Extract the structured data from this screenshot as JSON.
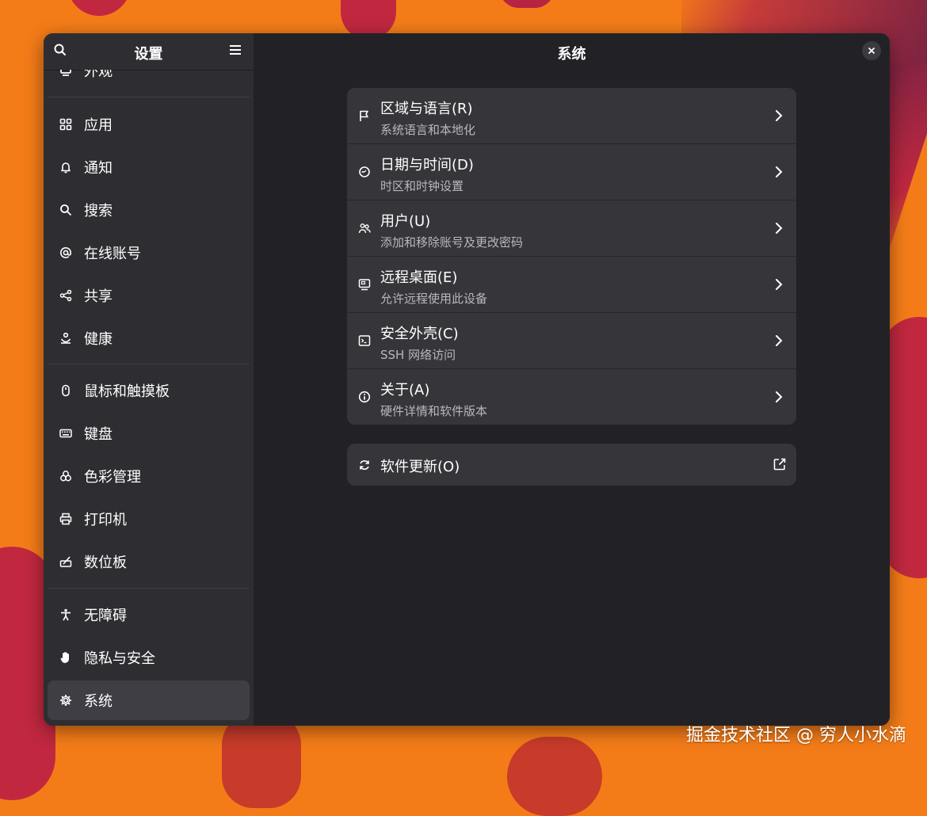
{
  "sidebar": {
    "title": "设置",
    "items": [
      {
        "label": "外观",
        "icon": "appearance-icon"
      },
      {
        "label": "应用",
        "icon": "apps-icon"
      },
      {
        "label": "通知",
        "icon": "bell-icon"
      },
      {
        "label": "搜索",
        "icon": "search-icon"
      },
      {
        "label": "在线账号",
        "icon": "at-icon"
      },
      {
        "label": "共享",
        "icon": "share-icon"
      },
      {
        "label": "健康",
        "icon": "wellbeing-icon"
      },
      {
        "label": "鼠标和触摸板",
        "icon": "mouse-icon"
      },
      {
        "label": "键盘",
        "icon": "keyboard-icon"
      },
      {
        "label": "色彩管理",
        "icon": "color-icon"
      },
      {
        "label": "打印机",
        "icon": "printer-icon"
      },
      {
        "label": "数位板",
        "icon": "tablet-icon"
      },
      {
        "label": "无障碍",
        "icon": "accessibility-icon"
      },
      {
        "label": "隐私与安全",
        "icon": "hand-icon"
      },
      {
        "label": "系统",
        "icon": "gear-icon",
        "active": true
      }
    ]
  },
  "main": {
    "title": "系统",
    "rows": [
      {
        "title": "区域与语言(R)",
        "subtitle": "系统语言和本地化",
        "icon": "flag-icon"
      },
      {
        "title": "日期与时间(D)",
        "subtitle": "时区和时钟设置",
        "icon": "clock-icon"
      },
      {
        "title": "用户(U)",
        "subtitle": "添加和移除账号及更改密码",
        "icon": "users-icon"
      },
      {
        "title": "远程桌面(E)",
        "subtitle": "允许远程使用此设备",
        "icon": "remote-desktop-icon"
      },
      {
        "title": "安全外壳(C)",
        "subtitle": "SSH 网络访问",
        "icon": "terminal-icon"
      },
      {
        "title": "关于(A)",
        "subtitle": "硬件详情和软件版本",
        "icon": "info-icon"
      }
    ],
    "software_update": {
      "title": "软件更新(O)",
      "icon": "refresh-icon"
    }
  },
  "watermark": "掘金技术社区 @ 穷人小水滴",
  "colors": {
    "window_bg": "#222226",
    "sidebar_bg": "#2e2e32",
    "row_bg": "#36363a",
    "active_bg": "#3e3e44",
    "wallpaper": "#f47c18"
  }
}
